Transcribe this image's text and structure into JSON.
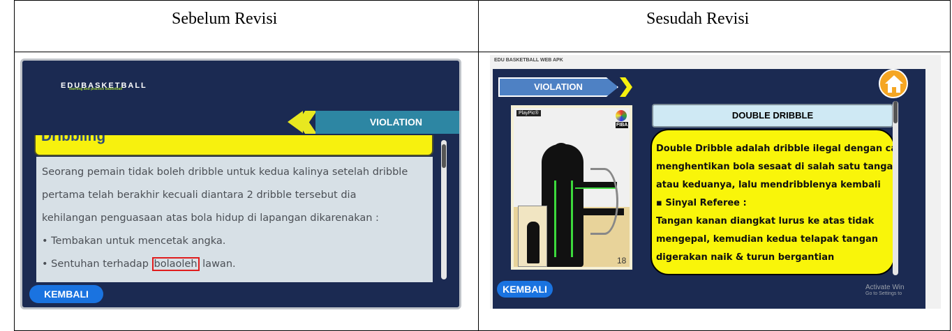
{
  "table": {
    "header_left": "Sebelum Revisi",
    "header_right": "Sesudah Revisi"
  },
  "before": {
    "logo_text": "EDUBASKETBALL",
    "logo_subtitle": "learning and practice basketball",
    "section_label": "VIOLATION",
    "heading": "Dribbling",
    "lines": [
      "Seorang pemain tidak boleh dribble untuk kedua kalinya setelah dribble",
      "pertama telah berakhir kecuali diantara 2 dribble tersebut dia",
      "kehilangan penguasaan atas bola hidup di lapangan dikarenakan :",
      "•  Tembakan untuk mencetak angka."
    ],
    "last_line_prefix": "•  Sentuhan terhadap ",
    "last_line_highlight": "bolaoleh",
    "last_line_suffix": " lawan.",
    "back_button": "KEMBALI",
    "highlight_color": "#e01c1c"
  },
  "after": {
    "window_title": "EDU BASKETBALL WEB APK",
    "section_label": "VIOLATION",
    "home_icon": "home-icon",
    "card_brand": "PlayPic®",
    "card_badge": "FIBA",
    "card_number": "18",
    "title": "DOUBLE DRIBBLE",
    "lines": [
      "Double Dribble adalah dribble ilegal dengan cara",
      "menghentikan bola sesaat di salah satu tangan",
      "atau keduanya, lalu mendribblenya kembali",
      "▪   Sinyal Referee :",
      "Tangan kanan diangkat lurus ke atas tidak",
      "mengepal, kemudian kedua telapak tangan",
      "digerakan naik & turun bergantian"
    ],
    "back_button": "KEMBALI",
    "watermark_line1": "Activate Win",
    "watermark_line2": "Go to Settings to"
  }
}
